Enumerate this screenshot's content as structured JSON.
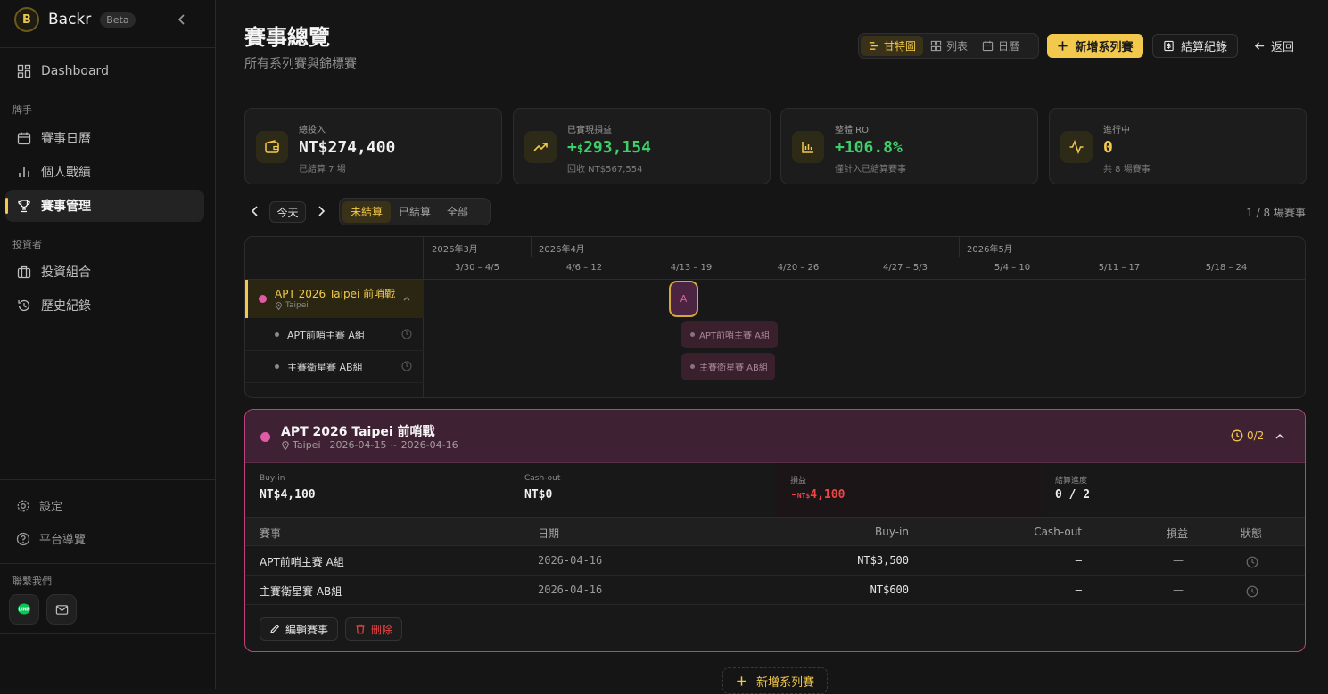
{
  "sidebar": {
    "brand": "Backr",
    "logo_letter": "B",
    "beta": "Beta",
    "dashboard": "Dashboard",
    "player_section": "牌手",
    "calendar": "賽事日曆",
    "stats": "個人戰績",
    "manage": "賽事管理",
    "investor_section": "投資者",
    "portfolio": "投資組合",
    "history": "歷史紀錄",
    "settings": "設定",
    "guide": "平台導覽",
    "contact_section": "聯繫我們"
  },
  "header": {
    "title": "賽事總覽",
    "subtitle": "所有系列賽與錦標賽",
    "views": [
      "甘特圖",
      "列表",
      "日曆"
    ],
    "add_series": "新增系列賽",
    "settlement_log": "結算紀錄",
    "back": "返回"
  },
  "stats": [
    {
      "label": "總投入",
      "value": "NT$274,400",
      "sub": "已結算 7 場",
      "icon": "wallet-icon"
    },
    {
      "label": "已實現損益",
      "value_prefix": "+",
      "value_currency": "$",
      "value": "293,154",
      "sub": "回收 NT$567,554",
      "icon": "trending-up-icon"
    },
    {
      "label": "整體 ROI",
      "value": "+106.8%",
      "sub": "僅計入已結算賽事",
      "icon": "bar-chart-icon"
    },
    {
      "label": "進行中",
      "value": "0",
      "sub": "共 8 場賽事",
      "icon": "activity-icon"
    }
  ],
  "filters": {
    "today": "今天",
    "tabs": [
      "未結算",
      "已結算",
      "全部"
    ],
    "count": "1 / 8 場賽事"
  },
  "gantt": {
    "months": [
      "2026年3月",
      "2026年4月",
      "2026年5月"
    ],
    "weeks": [
      "3/30 – 4/5",
      "4/6 – 12",
      "4/13 – 19",
      "4/20 – 26",
      "4/27 – 5/3",
      "5/4 – 10",
      "5/11 – 17",
      "5/18 – 24"
    ],
    "series_name": "APT 2026 Taipei 前哨戰",
    "series_location": "Taipei",
    "marker_label": "A",
    "events": [
      "APT前哨主賽 A組",
      "主賽衛星賽 AB組"
    ]
  },
  "detail": {
    "title": "APT 2026 Taipei 前哨戰",
    "location": "Taipei",
    "dates": "2026-04-15 ~ 2026-04-16",
    "progress": "0/2",
    "summary": {
      "buyin_label": "Buy-in",
      "buyin": "NT$4,100",
      "cashout_label": "Cash-out",
      "cashout": "NT$0",
      "pnl_label": "損益",
      "pnl_sign": "-",
      "pnl_currency": "NT$",
      "pnl_value": "4,100",
      "progress_label": "結算進度",
      "progress_value": "0 / 2"
    },
    "columns": [
      "賽事",
      "日期",
      "Buy-in",
      "Cash-out",
      "損益",
      "狀態"
    ],
    "rows": [
      {
        "name": "APT前哨主賽 A組",
        "date": "2026-04-16",
        "buyin": "NT$3,500",
        "cashout": "–",
        "pnl": "—"
      },
      {
        "name": "主賽衛星賽 AB組",
        "date": "2026-04-16",
        "buyin": "NT$600",
        "cashout": "–",
        "pnl": "—"
      }
    ],
    "edit": "編輯賽事",
    "delete": "刪除"
  },
  "add_series_bottom": "新增系列賽",
  "colors": {
    "accent": "#f2c94c",
    "series": "#e05aa6",
    "positive": "#3ecf6a",
    "negative": "#ef4444"
  }
}
